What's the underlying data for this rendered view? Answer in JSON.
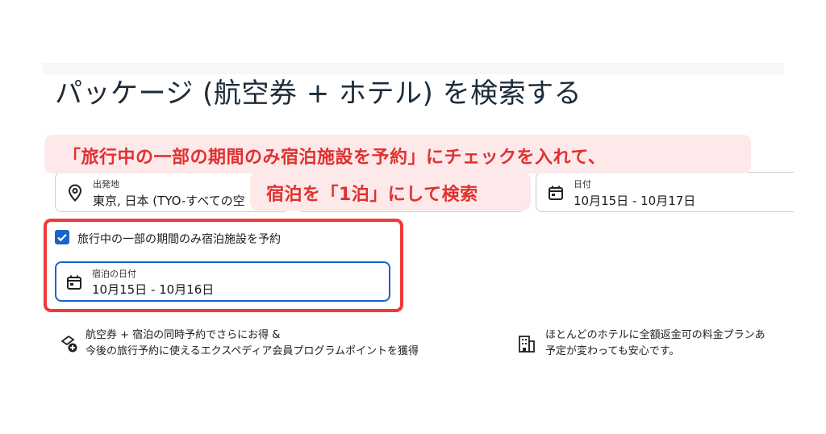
{
  "page": {
    "title": "パッケージ (航空券 + ホテル) を検索する"
  },
  "callout": {
    "line1": "「旅行中の一部の期間のみ宿泊施設を予約」にチェックを入れて、",
    "line2": "宿泊を「1泊」にして検索"
  },
  "search": {
    "origin": {
      "label": "出発地",
      "value": "東京, 日本 (TYO-すべての空",
      "icon": "location-pin-icon"
    },
    "dates": {
      "label": "日付",
      "value": "10月15日 - 10月17日",
      "icon": "calendar-icon"
    }
  },
  "partial_stay": {
    "checkbox_label": "旅行中の一部の期間のみ宿泊施設を予約",
    "checked": true,
    "stay_dates": {
      "label": "宿泊の日付",
      "value": "10月15日 - 10月16日",
      "icon": "calendar-icon"
    }
  },
  "benefits": [
    {
      "icon": "bundle-plus-icon",
      "line1": "航空券 + 宿泊の同時予約でさらにお得 &",
      "line2": "今後の旅行予約に使えるエクスペディア会員プログラムポイントを獲得"
    },
    {
      "icon": "building-icon",
      "line1": "ほとんどのホテルに全額返金可の料金プランあ",
      "line2": "予定が変わっても安心です。"
    }
  ],
  "colors": {
    "accent": "#1a63c7",
    "callout_text": "#e03131",
    "callout_bg": "#fde9e9",
    "highlight_border": "#f03a3a"
  }
}
